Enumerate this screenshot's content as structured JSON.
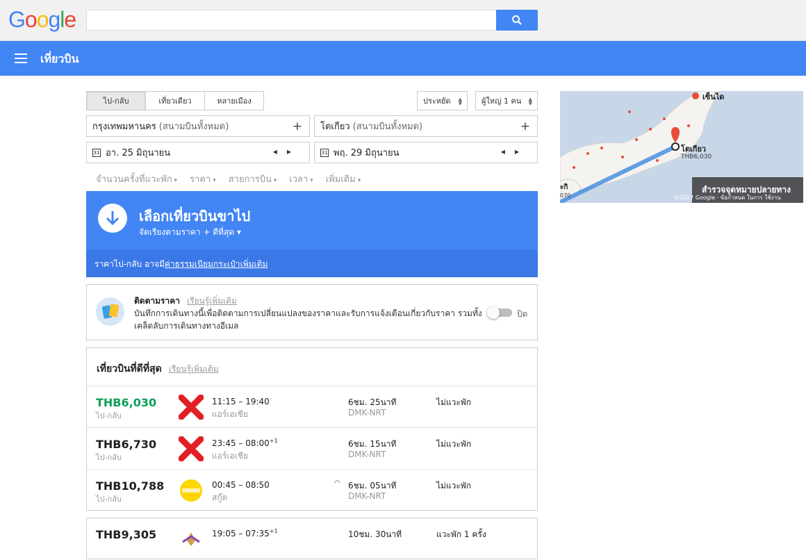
{
  "header": {
    "logo": "Google",
    "search_value": ""
  },
  "appbar": {
    "title": "เที่ยวบิน"
  },
  "trip_types": [
    "ไป-กลับ",
    "เที่ยวเดียว",
    "หลายเมือง"
  ],
  "cabin_class": "ประหยัด",
  "passengers": "ผู้ใหญ่ 1 คน",
  "origin": {
    "city": "กรุงเทพมหานคร",
    "airports": "(สนามบินทั้งหมด)"
  },
  "destination": {
    "city": "โตเกียว",
    "airports": "(สนามบินทั้งหมด)"
  },
  "depart_date": "อา. 25 มิถุนายน",
  "return_date": "พฤ. 29 มิถุนายน",
  "calendar_icon_text": "31",
  "filters": [
    "จำนวนครั้งที่แวะพัก",
    "ราคา",
    "สายการบิน",
    "เวลา",
    "เพิ่มเติม"
  ],
  "banner": {
    "title": "เลือกเที่ยวบินขาไป",
    "sort": "จัดเรียงตามราคา + ดีที่สุด ▾",
    "fee_prefix": "ราคาไป-กลับ อาจมี",
    "fee_link": "ค่าธรรมเนียมกระเป๋าเพิ่มเติม"
  },
  "tracking": {
    "title": "ติดตามราคา",
    "learn_more": "เรียนรู้เพิ่มเติม",
    "description": "บันทึกการเดินทางนี้เพื่อติดตามการเปลี่ยนแปลงของราคาและรับการแจ้งเตือนเกี่ยวกับราคา รวมทั้งเคล็ดลับการเดินทางทางอีเมล",
    "toggle_label": "ปิด"
  },
  "results": {
    "title": "เที่ยวบินที่ดีที่สุด",
    "learn_more": "เรียนรู้เพิ่มเติม",
    "flights": [
      {
        "price": "THB6,030",
        "price_note": "ไป-กลับ",
        "times": "11:15 – 19:40",
        "plus_day": "",
        "airline": "แอร์เอเชีย",
        "duration": "6ชม. 25นาที",
        "route": "DMK-NRT",
        "stops": "ไม่แวะพัก"
      },
      {
        "price": "THB6,730",
        "price_note": "ไป-กลับ",
        "times": "23:45 – 08:00",
        "plus_day": "+1",
        "airline": "แอร์เอเชีย",
        "duration": "6ชม. 15นาที",
        "route": "DMK-NRT",
        "stops": "ไม่แวะพัก"
      },
      {
        "price": "THB10,788",
        "price_note": "ไป-กลับ",
        "times": "00:45 – 08:50",
        "plus_day": "",
        "airline": "สกู๊ต",
        "duration": "6ชม. 05นาที",
        "route": "DMK-NRT",
        "stops": "ไม่แวะพัก"
      }
    ],
    "other": {
      "price": "THB9,305",
      "times": "19:05 – 07:35",
      "plus_day": "+1",
      "duration": "10ชม. 30นาที",
      "stops": "แวะพัก 1 ครั้ง"
    }
  },
  "map": {
    "city_top": "เซ็นได",
    "city_main": "โตเกียว",
    "city_main_price": "THB6,030",
    "city_left": "ะกิ",
    "city_left_price": "070",
    "explore": "สำรวจจุดหมายปลายทาง",
    "credit": "©2017 Google · ข้อกำหนด ในการ ใช้งาน"
  },
  "colors": {
    "brand_blue": "#4285f4",
    "best_price": "#0f9d58"
  }
}
